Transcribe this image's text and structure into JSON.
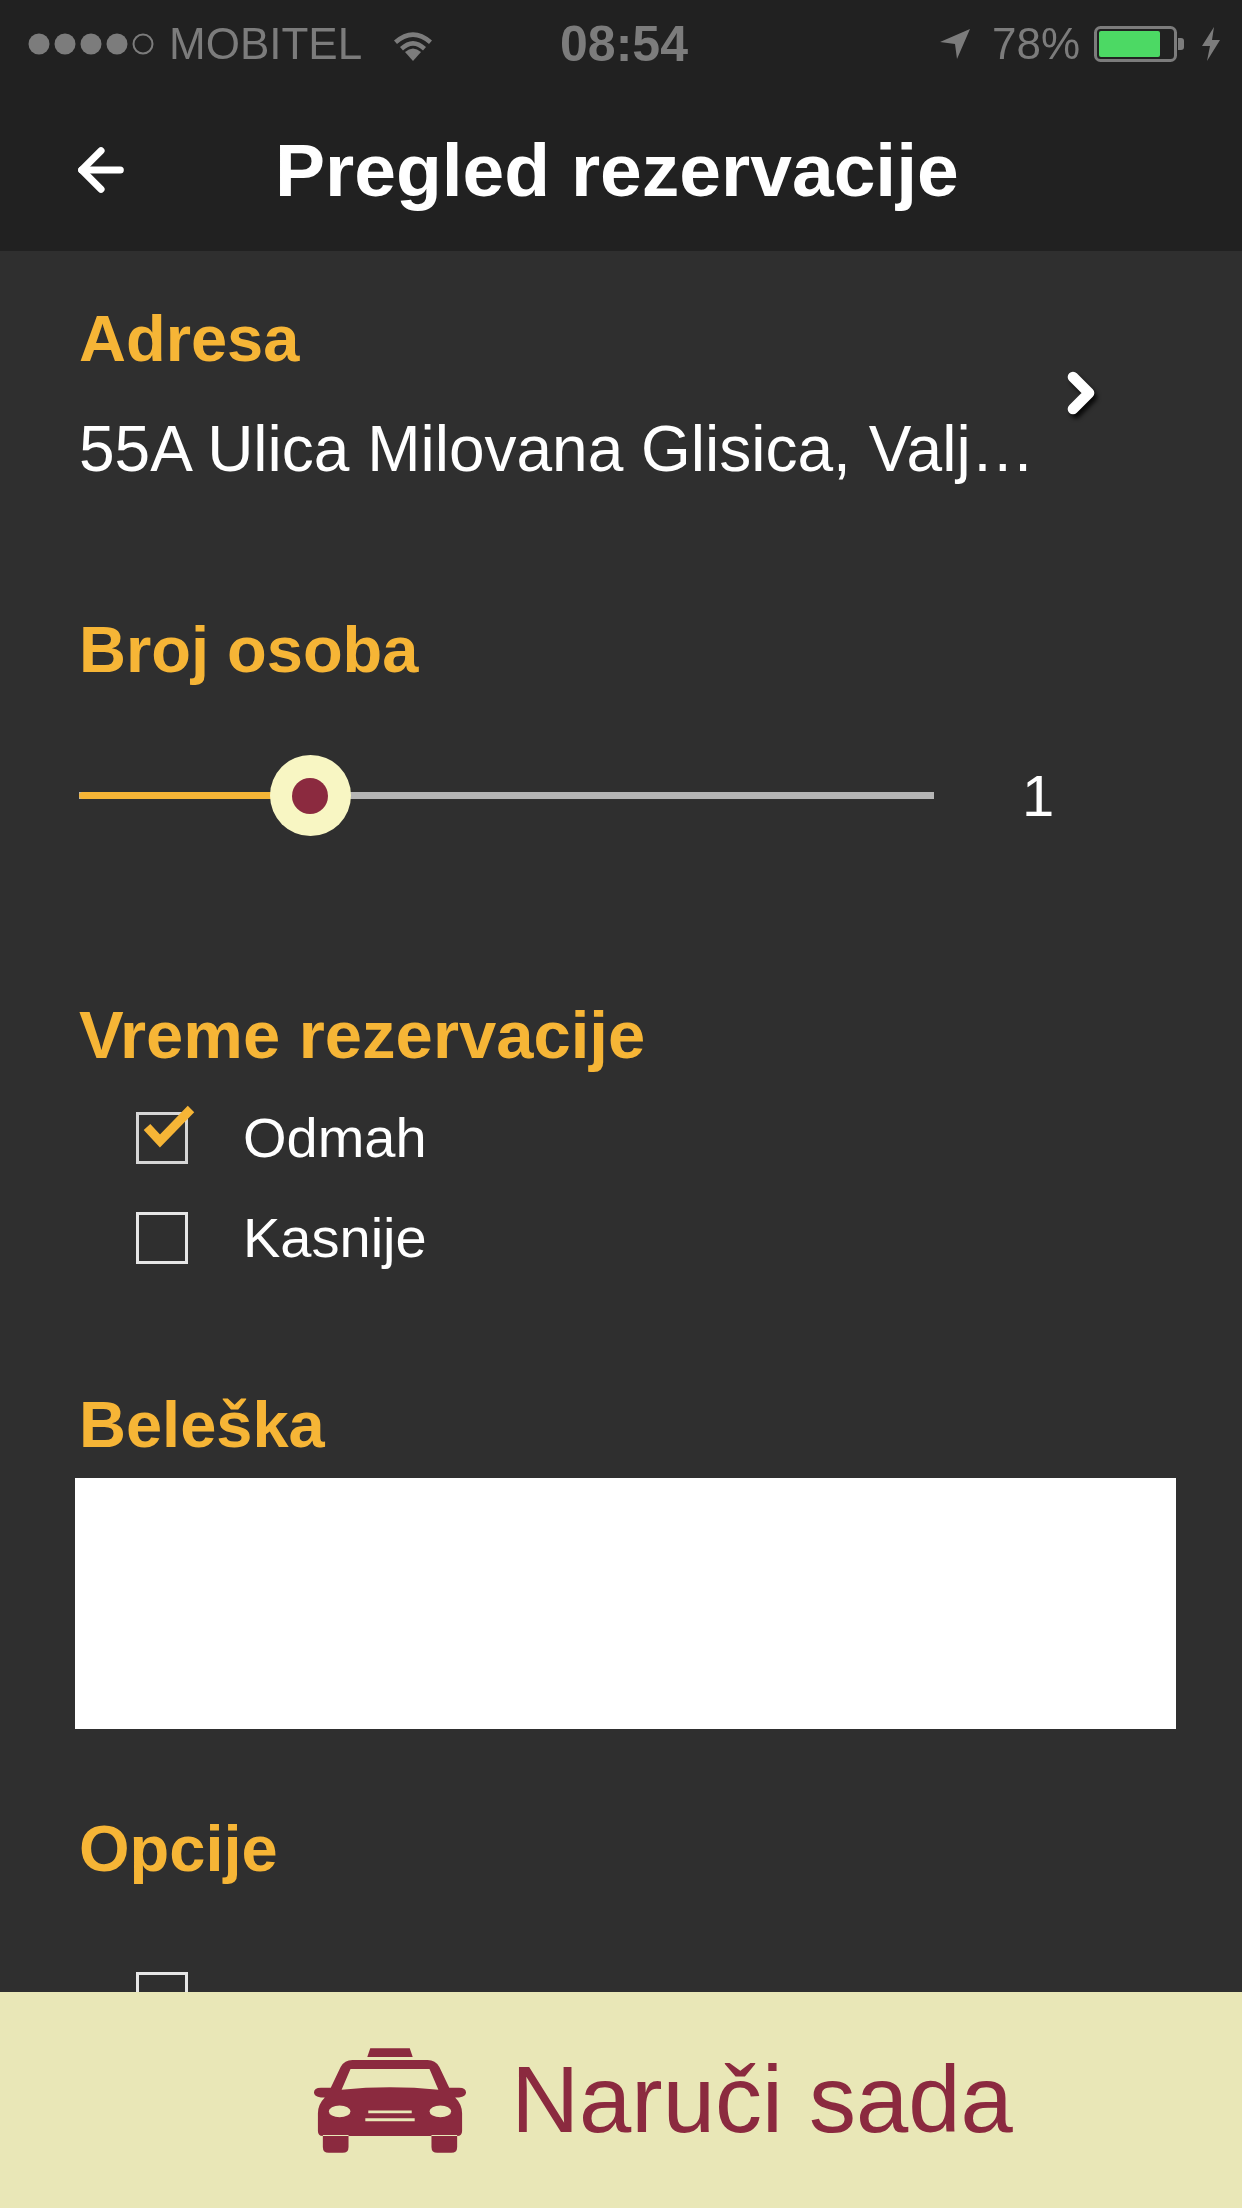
{
  "status_bar": {
    "carrier": "MOBITEL",
    "time": "08:54",
    "battery": "78%"
  },
  "header": {
    "title": "Pregled rezervacije"
  },
  "address": {
    "label": "Adresa",
    "value": "55A Ulica Milovana Glisica, Valj…"
  },
  "persons": {
    "label": "Broj osoba",
    "level": 0.27,
    "reading": "1"
  },
  "reservation_time": {
    "label": "Vreme rezervacije",
    "options": [
      {
        "label": "Odmah",
        "checked": true
      },
      {
        "label": "Kasnije",
        "checked": false
      }
    ]
  },
  "note": {
    "label": "Beleška"
  },
  "options": {
    "label": "Opcije",
    "items": [
      {
        "checked": false
      }
    ]
  },
  "order_button": {
    "label": "Naruči sada"
  }
}
